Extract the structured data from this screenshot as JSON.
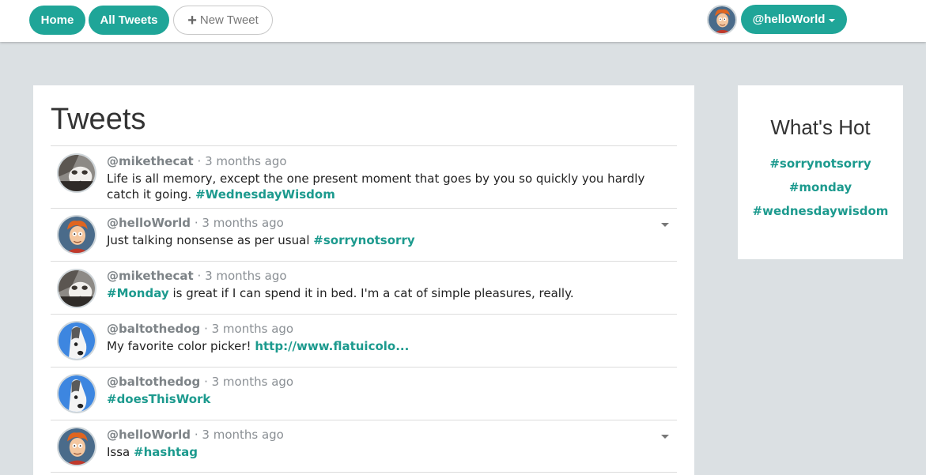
{
  "nav": {
    "home_label": "Home",
    "all_tweets_label": "All Tweets",
    "new_tweet_icon": "plus-icon",
    "new_tweet_label": "New Tweet",
    "user_label": "@helloWorld",
    "accent": "#1fa598"
  },
  "main": {
    "title": "Tweets",
    "tweets": [
      {
        "handle": "@mikethecat",
        "time": "3 months ago",
        "avatar": "cat-avatar",
        "text": "Life is all memory, except the one present moment that goes by you so quickly you hardly catch it going.",
        "tag": "#WednesdayWisdom",
        "has_menu": false
      },
      {
        "handle": "@helloWorld",
        "time": "3 months ago",
        "avatar": "fry-avatar",
        "text": "Just talking nonsense as per usual",
        "tag": "#sorrynotsorry",
        "has_menu": true
      },
      {
        "handle": "@mikethecat",
        "time": "3 months ago",
        "avatar": "cat-avatar",
        "tag": "#Monday",
        "text": "is great if I can spend it in bed. I'm a cat of simple pleasures, really.",
        "has_menu": false
      },
      {
        "handle": "@baltothedog",
        "time": "3 months ago",
        "avatar": "dog-avatar",
        "text": "My favorite color picker!",
        "tag": "http://www.flatuicolo...",
        "has_menu": false
      },
      {
        "handle": "@baltothedog",
        "time": "3 months ago",
        "avatar": "dog-avatar",
        "text": "",
        "tag": "#doesThisWork",
        "has_menu": false
      },
      {
        "handle": "@helloWorld",
        "time": "3 months ago",
        "avatar": "fry-avatar",
        "text": "Issa",
        "tag": "#hashtag",
        "has_menu": true
      }
    ]
  },
  "sidebar": {
    "title": "What's Hot",
    "tags": [
      "#sorrynotsorry",
      "#monday",
      "#wednesdaywisdom"
    ]
  },
  "meta_separator": "·"
}
